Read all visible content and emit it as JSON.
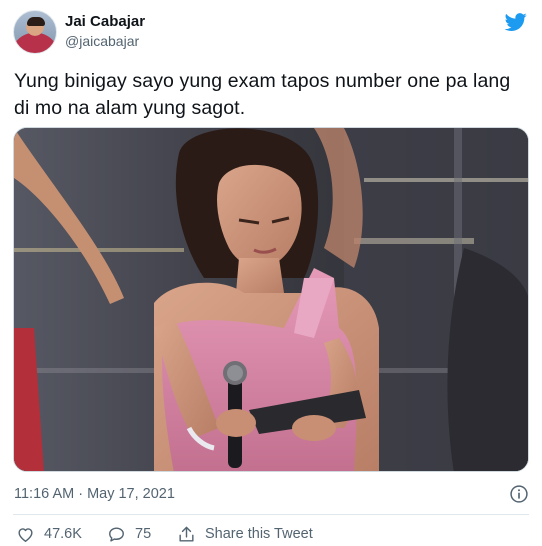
{
  "author": {
    "name": "Jai Cabajar",
    "handle": "@jaicabajar"
  },
  "tweet": {
    "text": "Yung binigay sayo yung exam tapos number one pa lang di mo na alam yung sagot.",
    "timestamp": "11:16 AM · May 17, 2021"
  },
  "actions": {
    "likes": "47.6K",
    "replies": "75",
    "share_label": "Share this Tweet"
  },
  "icons": {
    "brand": "twitter-bird-icon",
    "info": "info-icon",
    "like": "heart-icon",
    "reply": "speech-bubble-icon",
    "share": "share-upload-icon"
  },
  "colors": {
    "brand_blue": "#1d9bf0",
    "secondary_text": "#536471",
    "primary_text": "#0f1419",
    "divider": "#e1e8ed"
  }
}
